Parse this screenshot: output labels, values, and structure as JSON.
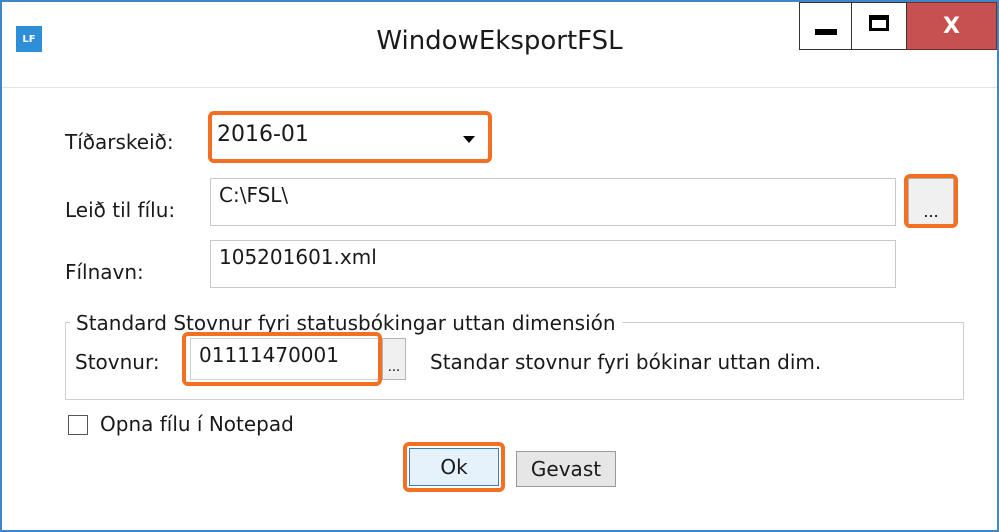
{
  "window": {
    "title": "WindowEksportFSL",
    "app_icon_text": "LF",
    "close_label": "X",
    "accent_color": "#3d87c7",
    "close_color": "#c75050",
    "highlight_color": "#f36f21"
  },
  "form": {
    "period_label": "Tíðarskeið:",
    "period_value": "2016-01",
    "path_label": "Leið til fílu:",
    "path_value": "C:\\FSL\\",
    "browse_label": "...",
    "filename_label": "Fílnavn:",
    "filename_value": "105201601.xml"
  },
  "group": {
    "legend": "Standard Stovnur fyri statusbókingar uttan dimensión",
    "institution_label": "Stovnur:",
    "institution_value": "01111470001",
    "browse_label": "...",
    "description": "Standar stovnur fyri bókinar uttan dim."
  },
  "options": {
    "notepad_label": "Opna fílu í Notepad",
    "notepad_checked": false
  },
  "buttons": {
    "ok_label": "Ok",
    "cancel_label": "Gevast"
  }
}
